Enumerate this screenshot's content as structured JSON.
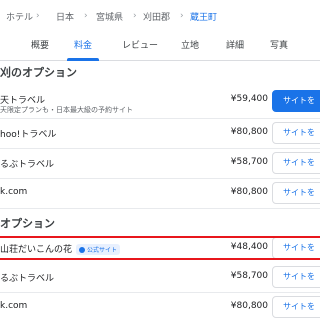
{
  "breadcrumb": [
    "ホテル",
    "日本",
    "宮城県",
    "刈田郡",
    "蔵王町"
  ],
  "tabs": [
    "概要",
    "料金",
    "レビュー",
    "立地",
    "詳細",
    "写真"
  ],
  "active_tab": "料金",
  "sections": [
    {
      "title": "刈のオプション",
      "rows": [
        {
          "name": "天トラベル",
          "sub": "天限定プランも・日本最大級の予約サイト",
          "price": "¥59,400",
          "button": "サイトを",
          "primary": true
        },
        {
          "name": "hoo!トラベル",
          "price": "¥80,800",
          "button": "サイトを",
          "primary": false
        },
        {
          "name": "るぶトラベル",
          "price": "¥58,700",
          "button": "サイトを",
          "primary": false
        },
        {
          "name": "k.com",
          "price": "¥80,800",
          "button": "サイトを",
          "primary": false
        }
      ]
    },
    {
      "title": "オプション",
      "rows": [
        {
          "name": "山荘だいこんの花",
          "badge": "公式サイト",
          "price": "¥48,400",
          "button": "サイトを",
          "primary": false
        },
        {
          "name": "るぶトラベル",
          "price": "¥58,700",
          "button": "サイトを",
          "primary": false
        },
        {
          "name": "k.com",
          "price": "¥80,800",
          "button": "サイトを",
          "primary": false
        }
      ]
    }
  ],
  "colors": {
    "accent": "#1a73e8",
    "highlight": "#e8171c",
    "divider": "#e8eaed"
  }
}
